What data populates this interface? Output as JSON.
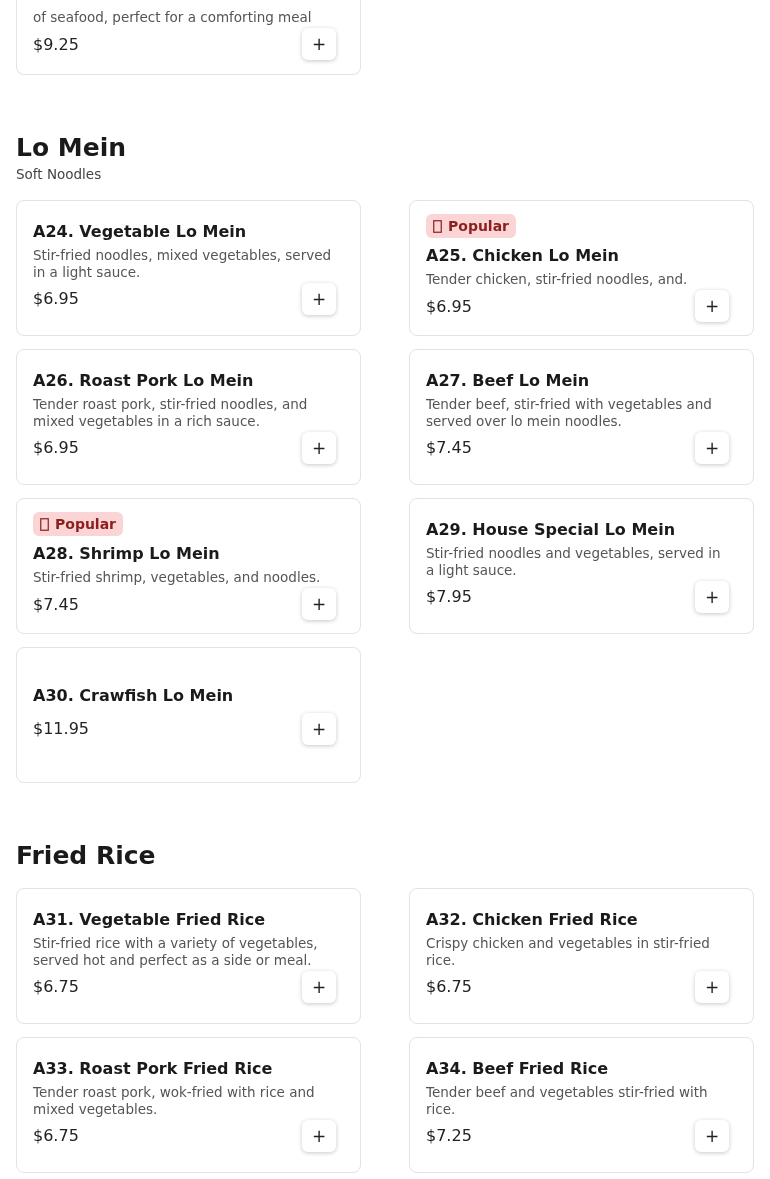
{
  "partial_item": {
    "description": "of seafood, perfect for a comforting meal",
    "price": "$9.25",
    "add_label": "+"
  },
  "sections": [
    {
      "title": "Lo Mein",
      "subtitle": "Soft Noodles",
      "items": [
        {
          "name": "A24. Vegetable Lo Mein",
          "description": "Stir-fried noodles, mixed vegetables, served in a light sauce.",
          "price": "$6.95",
          "popular": false,
          "add_label": "+"
        },
        {
          "name": "A25. Chicken Lo Mein",
          "description": "Tender chicken, stir-fried noodles, and.",
          "price": "$6.95",
          "popular": true,
          "badge": "Popular",
          "add_label": "+"
        },
        {
          "name": "A26. Roast Pork Lo Mein",
          "description": "Tender roast pork, stir-fried noodles, and mixed vegetables in a rich sauce.",
          "price": "$6.95",
          "popular": false,
          "add_label": "+"
        },
        {
          "name": "A27. Beef Lo Mein",
          "description": "Tender beef, stir-fried with vegetables and served over lo mein noodles.",
          "price": "$7.45",
          "popular": false,
          "add_label": "+"
        },
        {
          "name": "A28. Shrimp Lo Mein",
          "description": "Stir-fried shrimp, vegetables, and noodles.",
          "price": "$7.45",
          "popular": true,
          "badge": "Popular",
          "add_label": "+"
        },
        {
          "name": "A29. House Special Lo Mein",
          "description": "Stir-fried noodles and vegetables, served in a light sauce.",
          "price": "$7.95",
          "popular": false,
          "add_label": "+"
        },
        {
          "name": "A30. Crawfish Lo Mein",
          "price": "$11.95",
          "popular": false,
          "add_label": "+"
        }
      ]
    },
    {
      "title": "Fried Rice",
      "items": [
        {
          "name": "A31. Vegetable Fried Rice",
          "description": "Stir-fried rice with a variety of vegetables, served hot and perfect as a side or meal.",
          "price": "$6.75",
          "popular": false,
          "add_label": "+"
        },
        {
          "name": "A32. Chicken Fried Rice",
          "description": "Crispy chicken and vegetables in stir-fried rice.",
          "price": "$6.75",
          "popular": false,
          "add_label": "+"
        },
        {
          "name": "A33. Roast Pork Fried Rice",
          "description": "Tender roast pork, wok-fried with rice and mixed vegetables.",
          "price": "$6.75",
          "popular": false,
          "add_label": "+"
        },
        {
          "name": "A34. Beef Fried Rice",
          "description": "Tender beef and vegetables stir-fried with rice.",
          "price": "$7.25",
          "popular": false,
          "add_label": "+"
        }
      ]
    }
  ]
}
